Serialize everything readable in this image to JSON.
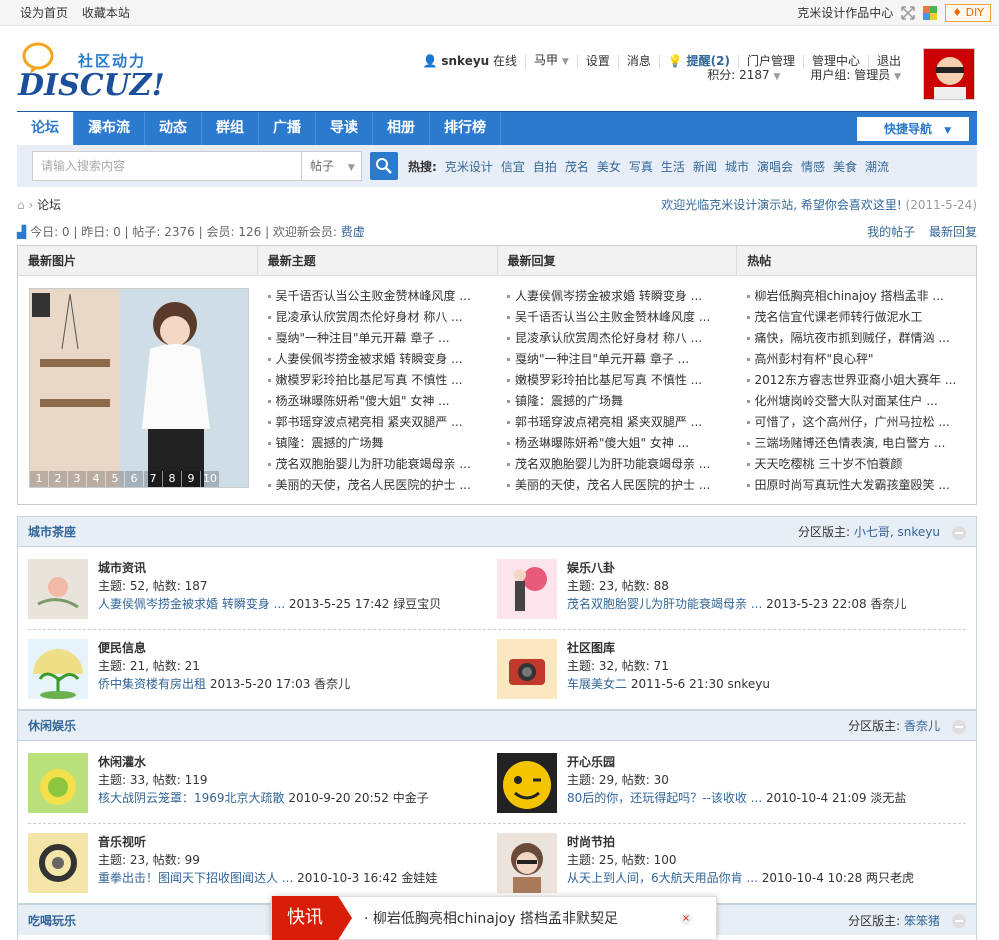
{
  "topbar": {
    "set_home": "设为首页",
    "bookmark": "收藏本站",
    "site_link": "克米设计作品中心",
    "diy": "DIY"
  },
  "logo": {
    "cn": "社区动力",
    "en": "DISCUZ!"
  },
  "user": {
    "name": "snkeyu",
    "online": "在线",
    "horse": "马甲",
    "settings": "设置",
    "messages": "消息",
    "remind": "提醒(2)",
    "portal": "门户管理",
    "admin": "管理中心",
    "logout": "退出",
    "points": "积分: 2187",
    "group": "用户组: 管理员"
  },
  "nav": {
    "items": [
      "论坛",
      "瀑布流",
      "动态",
      "群组",
      "广播",
      "导读",
      "相册",
      "排行榜"
    ],
    "quick": "快捷导航"
  },
  "search": {
    "placeholder": "请输入搜索内容",
    "select": "帖子",
    "hot_label": "热搜:",
    "keywords": [
      "克米设计",
      "信宜",
      "自拍",
      "茂名",
      "美女",
      "写真",
      "生活",
      "新闻",
      "城市",
      "演唱会",
      "情感",
      "美食",
      "潮流"
    ]
  },
  "crumb": {
    "current": "论坛",
    "welcome": "欢迎光临克米设计演示站, 希望你会喜欢这里!",
    "date": "(2011-5-24)"
  },
  "stats": {
    "today": "今日: 0",
    "yesterday": "昨日: 0",
    "posts": "帖子: 2376",
    "members": "会员: 126",
    "new_label": "欢迎新会员:",
    "new_member": "费虚",
    "my_posts": "我的帖子",
    "latest_reply": "最新回复"
  },
  "grid": {
    "headers": [
      "最新图片",
      "最新主题",
      "最新回复",
      "热帖"
    ],
    "pages": [
      "1",
      "2",
      "3",
      "4",
      "5",
      "6",
      "7",
      "8",
      "9",
      "10"
    ],
    "new_topics": [
      "吴千语否认当公主败金赞林峰风度 ...",
      "昆凌承认欣赏周杰伦好身材 称八 ...",
      "戛纳\"一种注目\"单元开幕 章子 ...",
      "人妻侯佩岑捞金被求婚 转瞬变身 ...",
      "嫩模罗彩玲拍比基尼写真 不慎性 ...",
      "杨丞琳曝陈妍希\"傻大姐\" 女神 ...",
      "郭书瑶穿波点裙亮相 紧夹双腿严 ...",
      "镇隆：震撼的广场舞",
      "茂名双胞胎婴儿为肝功能衰竭母亲 ...",
      "美丽的天使，茂名人民医院的护士 ..."
    ],
    "new_replies": [
      "人妻侯佩岑捞金被求婚 转瞬变身 ...",
      "吴千语否认当公主败金赞林峰风度 ...",
      "昆凌承认欣赏周杰伦好身材 称八 ...",
      "戛纳\"一种注目\"单元开幕 章子 ...",
      "嫩模罗彩玲拍比基尼写真 不慎性 ...",
      "镇隆：震撼的广场舞",
      "郭书瑶穿波点裙亮相 紧夹双腿严 ...",
      "杨丞琳曝陈妍希\"傻大姐\" 女神 ...",
      "茂名双胞胎婴儿为肝功能衰竭母亲 ...",
      "美丽的天使，茂名人民医院的护士 ..."
    ],
    "hot": [
      "柳岩低胸亮相chinajoy 搭档孟非 ...",
      "茂名信宜代课老师转行做泥水工",
      "痛快，隔坑夜市抓到贼仔，群情汹 ...",
      "高州彭村有杯\"良心秤\"",
      "2012东方睿志世界亚裔小姐大赛年 ...",
      "化州塘岗岭交警大队对面某住户 ...",
      "可惜了，这个高州仔，广州马拉松 ...",
      "三端场赌博还色情表演, 电白警方 ...",
      "天天吃樱桃 三十岁不怕蓑颜",
      "田原时尚写真玩性大发霸孩童殴笑 ..."
    ]
  },
  "sections": [
    {
      "title": "城市茶座",
      "mod_label": "分区版主:",
      "mods": "小七哥, snkeyu",
      "forums": [
        {
          "name": "城市资讯",
          "stat": "主题: 52, 帖数: 187",
          "last": "人妻侯佩岑捞金被求婚 转瞬变身 ...",
          "meta": "2013-5-25 17:42 绿豆宝贝"
        },
        {
          "name": "娱乐八卦",
          "stat": "主题: 23, 帖数: 88",
          "last": "茂名双胞胎婴儿为肝功能衰竭母亲 ...",
          "meta": "2013-5-23 22:08 香奈儿"
        },
        {
          "name": "便民信息",
          "stat": "主题: 21, 帖数: 21",
          "last": "侨中集资楼有房出租",
          "meta": "2013-5-20 17:03 香奈儿"
        },
        {
          "name": "社区图库",
          "stat": "主题: 32, 帖数: 71",
          "last": "车展美女二",
          "meta": "2011-5-6 21:30 snkeyu"
        }
      ]
    },
    {
      "title": "休闲娱乐",
      "mod_label": "分区版主:",
      "mods": "香奈儿",
      "forums": [
        {
          "name": "休闲灌水",
          "stat": "主题: 33, 帖数: 119",
          "last": "核大战阴云笼罩：1969北京大疏散",
          "meta": "2010-9-20 20:52 中金子"
        },
        {
          "name": "开心乐园",
          "stat": "主题: 29, 帖数: 30",
          "last": "80后的你，还玩得起吗？--该收收 ...",
          "meta": "2010-10-4 21:09 淡无盐"
        },
        {
          "name": "音乐视听",
          "stat": "主题: 23, 帖数: 99",
          "last": "重拳出击！图闻天下招收图闻达人 ...",
          "meta": "2010-10-3 16:42 金娃娃"
        },
        {
          "name": "时尚节拍",
          "stat": "主题: 25, 帖数: 100",
          "last": "从天上到人间，6大航天用品你肯 ...",
          "meta": "2010-10-4 10:28 两只老虎"
        }
      ]
    },
    {
      "title": "吃喝玩乐",
      "mod_label": "分区版主:",
      "mods": "笨笨猪",
      "forums": []
    }
  ],
  "news": {
    "tag": "快讯",
    "text": "柳岩低胸亮相chinajoy 搭档孟非默契足"
  }
}
